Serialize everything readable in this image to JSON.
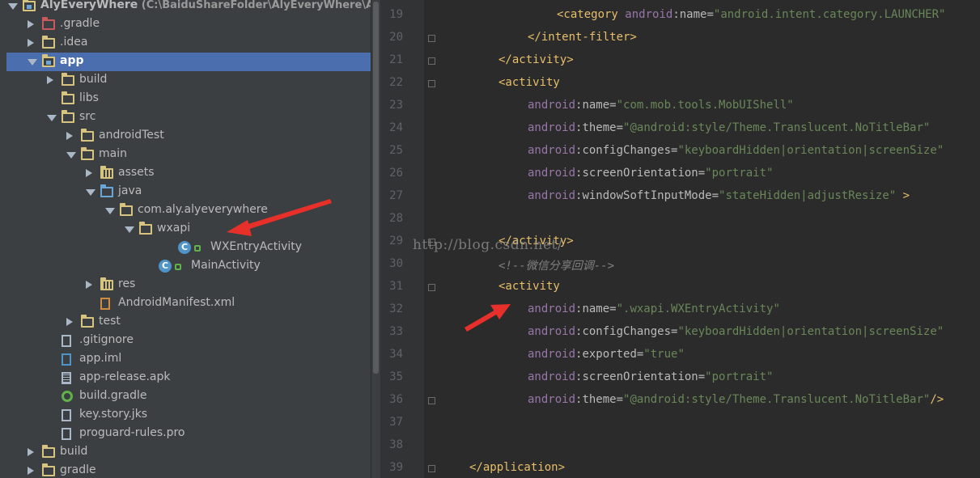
{
  "project_tree": {
    "items": [
      {
        "label": "AlyEveryWhere",
        "path": "(C:\\BaiduShareFolder\\AlyEveryWhere\\AlyEv",
        "depth": 0,
        "arrow": "open",
        "icon": "module-folder",
        "bold": true
      },
      {
        "label": ".gradle",
        "depth": 1,
        "arrow": "closed",
        "icon": "folder-red"
      },
      {
        "label": ".idea",
        "depth": 1,
        "arrow": "closed",
        "icon": "folder"
      },
      {
        "label": "app",
        "depth": 1,
        "arrow": "open",
        "icon": "module-folder",
        "selected": true,
        "bold": true
      },
      {
        "label": "build",
        "depth": 2,
        "arrow": "closed",
        "icon": "folder"
      },
      {
        "label": "libs",
        "depth": 2,
        "arrow": "none",
        "icon": "folder"
      },
      {
        "label": "src",
        "depth": 2,
        "arrow": "open",
        "icon": "folder"
      },
      {
        "label": "androidTest",
        "depth": 3,
        "arrow": "closed",
        "icon": "folder"
      },
      {
        "label": "main",
        "depth": 3,
        "arrow": "open",
        "icon": "folder"
      },
      {
        "label": "assets",
        "depth": 4,
        "arrow": "closed",
        "icon": "folder-grid"
      },
      {
        "label": "java",
        "depth": 4,
        "arrow": "open",
        "icon": "folder-blue"
      },
      {
        "label": "com.aly.alyeverywhere",
        "depth": 5,
        "arrow": "open",
        "icon": "package"
      },
      {
        "label": "wxapi",
        "depth": 6,
        "arrow": "open",
        "icon": "package"
      },
      {
        "label": "WXEntryActivity",
        "depth": 8,
        "arrow": "none",
        "icon": "class"
      },
      {
        "label": "MainActivity",
        "depth": 7,
        "arrow": "none",
        "icon": "class"
      },
      {
        "label": "res",
        "depth": 4,
        "arrow": "closed",
        "icon": "folder-grid"
      },
      {
        "label": "AndroidManifest.xml",
        "depth": 4,
        "arrow": "none",
        "icon": "xml-file"
      },
      {
        "label": "test",
        "depth": 3,
        "arrow": "closed",
        "icon": "folder"
      },
      {
        "label": ".gitignore",
        "depth": 2,
        "arrow": "none",
        "icon": "text-file"
      },
      {
        "label": "app.iml",
        "depth": 2,
        "arrow": "none",
        "icon": "iml-file"
      },
      {
        "label": "app-release.apk",
        "depth": 2,
        "arrow": "none",
        "icon": "apk-file"
      },
      {
        "label": "build.gradle",
        "depth": 2,
        "arrow": "none",
        "icon": "gradle-file"
      },
      {
        "label": "key.story.jks",
        "depth": 2,
        "arrow": "none",
        "icon": "text-file"
      },
      {
        "label": "proguard-rules.pro",
        "depth": 2,
        "arrow": "none",
        "icon": "text-file"
      },
      {
        "label": "build",
        "depth": 1,
        "arrow": "closed",
        "icon": "folder"
      },
      {
        "label": "gradle",
        "depth": 1,
        "arrow": "closed",
        "icon": "folder"
      }
    ]
  },
  "editor": {
    "lines": [
      {
        "n": "19",
        "indent": 4,
        "parts": [
          [
            "tg",
            "<category "
          ],
          [
            "ns",
            "android"
          ],
          [
            "at",
            ":name="
          ],
          [
            "vl",
            "\"android.intent.category.LAUNCHER\""
          ]
        ]
      },
      {
        "n": "20",
        "indent": 3,
        "parts": [
          [
            "tg",
            "</intent-filter>"
          ]
        ]
      },
      {
        "n": "21",
        "indent": 2,
        "parts": [
          [
            "tg",
            "</activity>"
          ]
        ]
      },
      {
        "n": "22",
        "indent": 2,
        "parts": [
          [
            "tg",
            "<activity"
          ]
        ]
      },
      {
        "n": "23",
        "indent": 3,
        "parts": [
          [
            "ns",
            "android"
          ],
          [
            "at",
            ":name="
          ],
          [
            "vl",
            "\"com.mob.tools.MobUIShell\""
          ]
        ]
      },
      {
        "n": "24",
        "indent": 3,
        "parts": [
          [
            "ns",
            "android"
          ],
          [
            "at",
            ":theme="
          ],
          [
            "vl",
            "\"@android:style/Theme.Translucent.NoTitleBar\""
          ]
        ]
      },
      {
        "n": "25",
        "indent": 3,
        "parts": [
          [
            "ns",
            "android"
          ],
          [
            "at",
            ":configChanges="
          ],
          [
            "vl",
            "\"keyboardHidden|orientation|screenSize\""
          ]
        ]
      },
      {
        "n": "26",
        "indent": 3,
        "parts": [
          [
            "ns",
            "android"
          ],
          [
            "at",
            ":screenOrientation="
          ],
          [
            "vl",
            "\"portrait\""
          ]
        ]
      },
      {
        "n": "27",
        "indent": 3,
        "parts": [
          [
            "ns",
            "android"
          ],
          [
            "at",
            ":windowSoftInputMode="
          ],
          [
            "vl",
            "\"stateHidden|adjustResize\""
          ],
          [
            "tg",
            " >"
          ]
        ]
      },
      {
        "n": "28",
        "indent": 0,
        "parts": []
      },
      {
        "n": "29",
        "indent": 2,
        "parts": [
          [
            "tg",
            "</activity>"
          ]
        ]
      },
      {
        "n": "30",
        "indent": 2,
        "parts": [
          [
            "cm",
            "<!--微信分享回调-->"
          ]
        ]
      },
      {
        "n": "31",
        "indent": 2,
        "parts": [
          [
            "tg",
            "<activity"
          ]
        ]
      },
      {
        "n": "32",
        "indent": 3,
        "parts": [
          [
            "ns",
            "android"
          ],
          [
            "at",
            ":name="
          ],
          [
            "vl",
            "\".wxapi.WXEntryActivity\""
          ]
        ]
      },
      {
        "n": "33",
        "indent": 3,
        "parts": [
          [
            "ns",
            "android"
          ],
          [
            "at",
            ":configChanges="
          ],
          [
            "vl",
            "\"keyboardHidden|orientation|screenSize\""
          ]
        ]
      },
      {
        "n": "34",
        "indent": 3,
        "parts": [
          [
            "ns",
            "android"
          ],
          [
            "at",
            ":exported="
          ],
          [
            "vl",
            "\"true\""
          ]
        ]
      },
      {
        "n": "35",
        "indent": 3,
        "parts": [
          [
            "ns",
            "android"
          ],
          [
            "at",
            ":screenOrientation="
          ],
          [
            "vl",
            "\"portrait\""
          ]
        ]
      },
      {
        "n": "36",
        "indent": 3,
        "parts": [
          [
            "ns",
            "android"
          ],
          [
            "at",
            ":theme="
          ],
          [
            "vl",
            "\"@android:style/Theme.Translucent.NoTitleBar\""
          ],
          [
            "tg",
            "/>"
          ]
        ]
      },
      {
        "n": "37",
        "indent": 0,
        "parts": []
      },
      {
        "n": "38",
        "indent": 0,
        "parts": []
      },
      {
        "n": "39",
        "indent": 1,
        "parts": [
          [
            "tg",
            "</application>"
          ]
        ]
      }
    ]
  },
  "watermark": "http://blog.csdn.net/",
  "colors": {
    "tag": "#e8bf6a",
    "namespace": "#9876aa",
    "value": "#6a8759",
    "selection": "#4b6eaf",
    "annotation_arrow": "#e8302b"
  }
}
